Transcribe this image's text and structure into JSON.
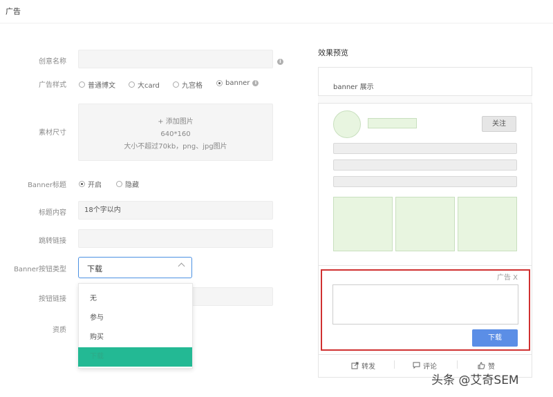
{
  "header": {
    "title": "广告"
  },
  "form": {
    "creative_name_label": "创意名称",
    "ad_style_label": "广告样式",
    "ad_style_options": [
      "普通博文",
      "大card",
      "九宫格",
      "banner"
    ],
    "material_size_label": "素材尺寸",
    "upload": {
      "add_label": "+ 添加图片",
      "size": "640*160",
      "hint": "大小不超过70kb，png、jpg图片"
    },
    "banner_title_label": "Banner标题",
    "banner_title_options": [
      "开启",
      "隐藏"
    ],
    "title_content_label": "标题内容",
    "title_content_value": "18个字以内",
    "jump_link_label": "跳转链接",
    "button_type_label": "Banner按钮类型",
    "button_type_value": "下载",
    "button_link_label": "按钮链接",
    "qualification_label": "资质",
    "dropdown_options": [
      "无",
      "参与",
      "购买",
      "下载"
    ]
  },
  "preview": {
    "title": "效果预览",
    "banner_label": "banner 展示",
    "follow_label": "关注",
    "ad_close_label": "广告 X",
    "download_label": "下载",
    "actions": [
      "转发",
      "评论",
      "赞"
    ]
  },
  "watermark": "头条 @艾奇SEM",
  "colors": {
    "accent_green": "#23b994",
    "download_blue": "#5b8ee6",
    "highlight_red": "#d03030",
    "select_border": "#4a90e2"
  }
}
